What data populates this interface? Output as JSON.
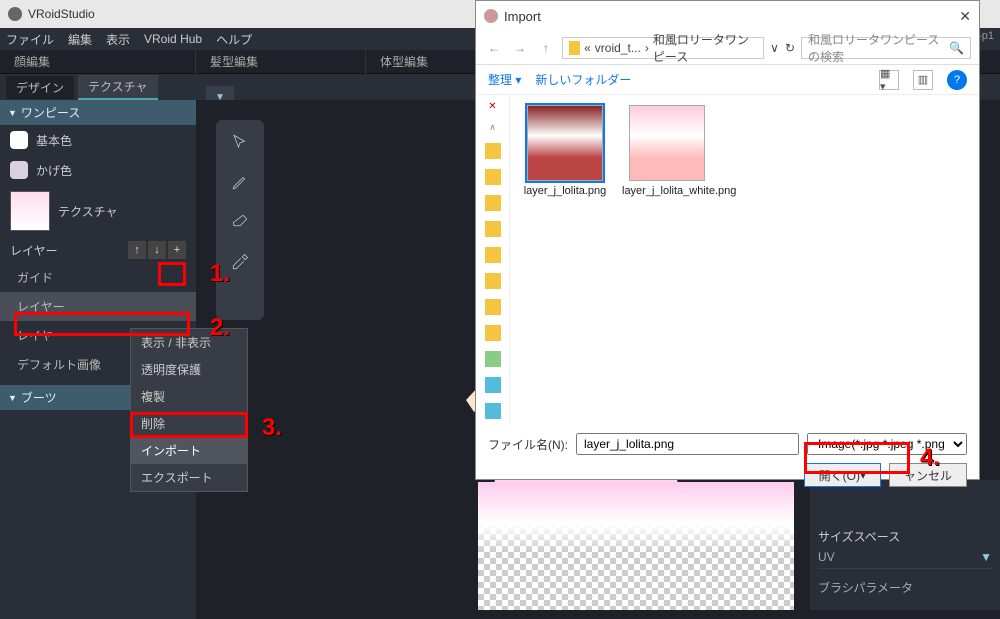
{
  "app": {
    "title": "VRoidStudio",
    "version_label": "4-p1"
  },
  "win_buttons": {
    "min": "—",
    "max": "□",
    "close": "✕"
  },
  "menu": {
    "file": "ファイル",
    "edit": "編集",
    "view": "表示",
    "hub": "VRoid Hub",
    "help": "ヘルプ"
  },
  "main_tabs": {
    "face": "顔編集",
    "hair": "髪型編集",
    "body": "体型編集"
  },
  "sub_tabs": {
    "design": "デザイン",
    "texture": "テクスチャ"
  },
  "left": {
    "section_onepiece": "ワンピース",
    "base_color": "基本色",
    "shade_color": "かげ色",
    "texture": "テクスチャ",
    "layer_label": "レイヤー",
    "guide": "ガイド",
    "layer_item1": "レイヤー",
    "layer_item2": "レイヤー",
    "default_image": "デフォルト画像",
    "section_boots": "ブーツ"
  },
  "layer_controls": {
    "up": "↑",
    "down": "↓",
    "add": "+"
  },
  "context": {
    "show": "表示 / 非表示",
    "translucent": "透明度保護",
    "duplicate": "複製",
    "delete": "削除",
    "import": "インポート",
    "export": "エクスポート"
  },
  "dialog": {
    "title": "Import",
    "path_parts": {
      "p1": "vroid_t...",
      "p2": "和風ロリータワンピース"
    },
    "refresh": "↻",
    "search_placeholder": "和風ロリータワンピースの検索",
    "organize": "整理",
    "new_folder": "新しいフォルダー",
    "help_icon": "?",
    "files": [
      {
        "name": "layer_j_lolita.png",
        "selected": true
      },
      {
        "name": "layer_j_lolita_white.png",
        "selected": false
      }
    ],
    "filename_label": "ファイル名(N):",
    "filename_value": "layer_j_lolita.png",
    "filter": "Image(*.jpg *.jpeg *.png)",
    "open": "開く(O)",
    "cancel": "ャンセル"
  },
  "right": {
    "size_space": "サイズスペース",
    "uv": "UV",
    "brush_param": "ブラシパラメータ"
  },
  "annot": {
    "n1": "1.",
    "n2": "2.",
    "n3": "3.",
    "n4": "4."
  }
}
